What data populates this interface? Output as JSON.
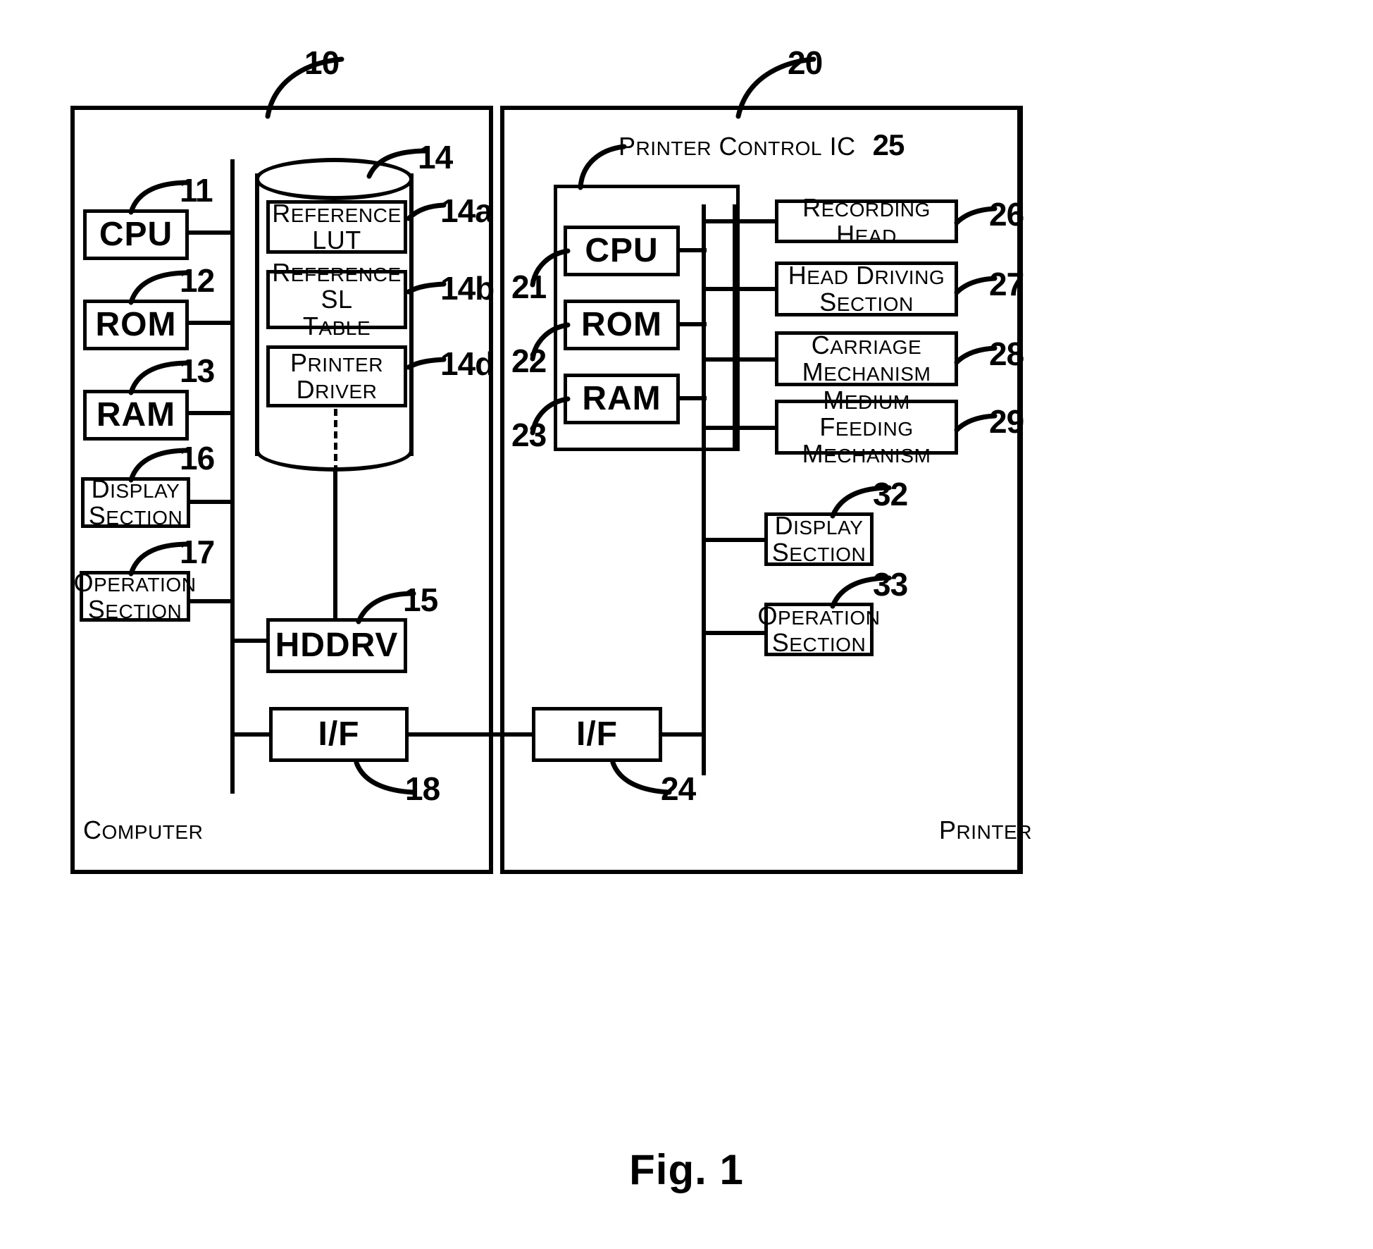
{
  "figure": {
    "caption": "Fig. 1"
  },
  "panels": {
    "computer": {
      "label": "Computer",
      "ref": "10"
    },
    "printer": {
      "label": "Printer",
      "ref": "20"
    }
  },
  "computer": {
    "blocks": [
      {
        "label": "CPU",
        "ref": "11"
      },
      {
        "label": "ROM",
        "ref": "12"
      },
      {
        "label": "RAM",
        "ref": "13"
      },
      {
        "label": "Display Section",
        "line1": "Display",
        "line2": "Section",
        "ref": "16"
      },
      {
        "label": "Operation Section",
        "line1": "Operation",
        "line2": "Section",
        "ref": "17"
      },
      {
        "label": "HDDRV",
        "ref": "15"
      },
      {
        "label": "I/F",
        "ref": "18"
      }
    ],
    "storage": {
      "ref": "14",
      "items": [
        {
          "line1": "Reference",
          "line2": "LUT",
          "ref": "14a"
        },
        {
          "line1": "Reference SL",
          "line2": "Table",
          "ref": "14b"
        },
        {
          "line1": "Printer",
          "line2": "Driver",
          "ref": "14d"
        }
      ]
    }
  },
  "printer": {
    "control_ic": {
      "label": "Printer Control IC",
      "ref": "25"
    },
    "core_blocks": [
      {
        "label": "CPU",
        "ref": "21"
      },
      {
        "label": "ROM",
        "ref": "22"
      },
      {
        "label": "RAM",
        "ref": "23"
      }
    ],
    "peripherals": [
      {
        "label": "Recording Head",
        "line1": "Recording Head",
        "line2": "",
        "ref": "26"
      },
      {
        "label": "Head Driving Section",
        "line1": "Head Driving",
        "line2": "Section",
        "ref": "27"
      },
      {
        "label": "Carriage Mechanism",
        "line1": "Carriage",
        "line2": "Mechanism",
        "ref": "28"
      },
      {
        "label": "Medium Feeding Mechanism",
        "line1": "Medium Feeding",
        "line2": "Mechanism",
        "ref": "29"
      }
    ],
    "io_blocks": [
      {
        "label": "Display Section",
        "line1": "Display",
        "line2": "Section",
        "ref": "32"
      },
      {
        "label": "Operation Section",
        "line1": "Operation",
        "line2": "Section",
        "ref": "33"
      },
      {
        "label": "I/F",
        "ref": "24"
      }
    ]
  },
  "colors": {
    "ink": "#000000",
    "paper": "#ffffff"
  }
}
